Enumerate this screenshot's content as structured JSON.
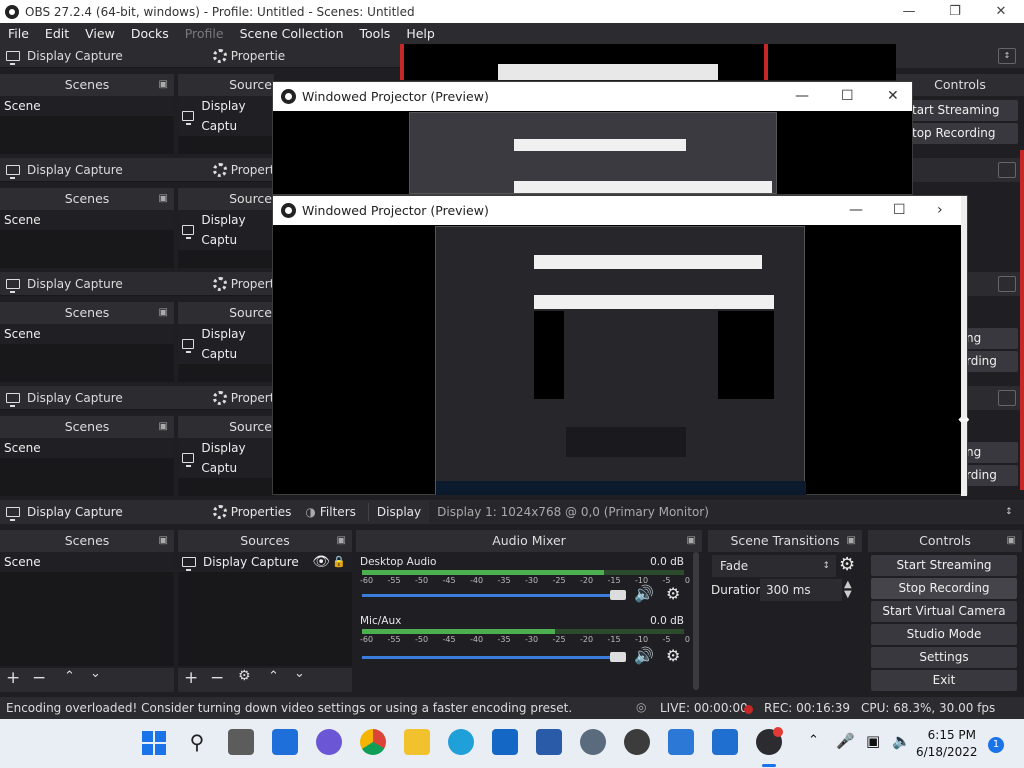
{
  "title_bar": {
    "title": "OBS 27.2.4 (64-bit, windows) - Profile: Untitled - Scenes: Untitled"
  },
  "menu": [
    "File",
    "Edit",
    "View",
    "Docks",
    "Profile",
    "Scene Collection",
    "Tools",
    "Help"
  ],
  "toolbar": {
    "source_name": "Display Capture",
    "properties": "Properties",
    "filters": "Filters",
    "display_label": "Display",
    "display_value": "Display 1: 1024x768 @ 0,0 (Primary Monitor)"
  },
  "repeat_toolbar": {
    "source_name": "Display Capture",
    "properties": "Propertie"
  },
  "docks": {
    "scenes": "Scenes",
    "sources": "Sources",
    "source_trunc": "Source",
    "audio_mixer": "Audio Mixer",
    "scene_transitions": "Scene Transitions",
    "controls": "Controls"
  },
  "scene_item": "Scene",
  "source_item": "Display Capture",
  "source_item_trunc": "Display Captu",
  "projectors": [
    {
      "title": "Windowed Projector (Preview)"
    },
    {
      "title": "Windowed Projector (Preview)"
    }
  ],
  "right_partial": [
    "Controls",
    "tart Streaming",
    "top Recording",
    "ng",
    "rding"
  ],
  "audio": {
    "tracks": [
      {
        "name": "Desktop Audio",
        "db": "0.0 dB",
        "level": 0.75
      },
      {
        "name": "Mic/Aux",
        "db": "0.0 dB",
        "level": 0.6
      }
    ],
    "ticks": [
      "-60",
      "-55",
      "-50",
      "-45",
      "-40",
      "-35",
      "-30",
      "-25",
      "-20",
      "-15",
      "-10",
      "-5",
      "0"
    ]
  },
  "transitions": {
    "selected": "Fade",
    "duration_label": "Duration",
    "duration_value": "300 ms"
  },
  "controls": [
    "Start Streaming",
    "Stop Recording",
    "Start Virtual Camera",
    "Studio Mode",
    "Settings",
    "Exit"
  ],
  "status": {
    "message": "Encoding overloaded! Consider turning down video settings or using a faster encoding preset.",
    "live": "LIVE: 00:00:00",
    "rec": "REC: 00:16:39",
    "cpu": "CPU: 68.3%, 30.00 fps"
  },
  "clock": {
    "time": "6:15 PM",
    "date": "6/18/2022"
  },
  "notification_count": "1",
  "colors": {
    "accent_red": "#c62828",
    "meter_green": "#4caf50",
    "meter_yellow": "#c9b037",
    "slider_blue": "#3b7ddd"
  }
}
